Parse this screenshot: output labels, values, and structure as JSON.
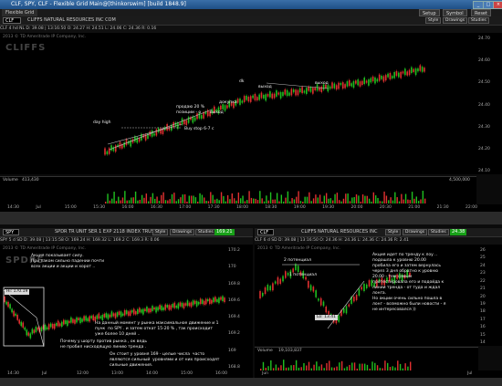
{
  "titlebar": {
    "title": "CLF, SPY, CLF - Flexible Grid Main@[thinkorswim] [build 1848.9]"
  },
  "window_controls": [
    "_",
    "□",
    "×"
  ],
  "tabs": [
    "Flexible Grid"
  ],
  "top_buttons": [
    "Setup",
    "Symbol",
    "Reset"
  ],
  "top": {
    "symbol": "CLF",
    "desc": "CLIFFS NATURAL RESOURCES INC COM",
    "quote": "CLF 4 hd NL  D: 39.08 | 13:16:50  O: 24.27  H: 24.51  L: 24.06  C: 24.36  R: 0.16",
    "copyright": "2013 © TD Ameritrade IP Company, Inc.",
    "logo": "CLIFFS",
    "buttons": [
      "Style",
      "Drawings",
      "Studies"
    ],
    "annotations": {
      "day_high": "day high",
      "buy_stop": "Buy stop 6-7 c",
      "sold": "продаю 20 %\nпозиции - о",
      "exit1": "выход",
      "addon": "докупка",
      "exit2": "выход",
      "exit3": "выход",
      "dk": "dk"
    },
    "price_ticks": [
      "24.70",
      "24.60",
      "24.50",
      "24.40",
      "24.30",
      "24.20",
      "24.10"
    ],
    "time_ticks": [
      "14:30",
      "Jul",
      "15:00",
      "15:30",
      "16:00",
      "16:30",
      "17:00",
      "17:30",
      "18:00",
      "18:30",
      "19:00",
      "19:30",
      "20:00",
      "20:30",
      "21:00",
      "21:30",
      "22:00"
    ],
    "volume_label": "Volume",
    "volume_value": "413,430",
    "volume_right": "4,500,000"
  },
  "left": {
    "symbol": "SPY",
    "desc": "SPDR TR UNIT SER 1 EXP 2118 INDEX TRUST",
    "price": "169.21",
    "quote": "SPY 5 d SD  D: 39.08 | 13:15:58  O: 169.24  H: 169.32  L: 169.2  C: 169.3  R: 0.06",
    "buttons": [
      "Style",
      "Drawings",
      "Studies"
    ],
    "copyright": "2013 © TD Ameritrade IP Company, Inc.",
    "logo": "SPDRS",
    "hi_label": "Hi: 170.19",
    "price_ticks": [
      "170.2",
      "170",
      "169.8",
      "169.6",
      "169.4",
      "169.2",
      "169",
      "168.8"
    ],
    "time_ticks": [
      "14:30",
      "Jul",
      "12:00",
      "13:00",
      "14:00",
      "15:00",
      "16:00"
    ],
    "annotations": {
      "a1": "Акция показывает силу.\nПри таком сильно падении почти\nвсех акции и акции и хорот ..",
      "a2": "На данный момент у рынка максимальное движение и 1\nпунк  по SPY . и затем откат 15-20 % , так происходит\nуже более 10 дней ..",
      "a3": "Почему у шорту против рынка , ок ведь\nне пробил нисходящую линию тренда .",
      "a4": "Он стоит у уровня 169 - целые числа  часто\nявляются сильный  уровнями и от них происходят\nсильные движения."
    }
  },
  "right": {
    "symbol": "CLF",
    "desc": "CLIFFS NATURAL RESOURCES INC",
    "price": "24.38",
    "quote": "CLF 6 d SD  D: 39.08 | 13:16:50  O: 24.36  H: 24.36  L: 24.36  C: 24.36  R: 2.41",
    "buttons": [
      "Style",
      "Drawings",
      "Studies"
    ],
    "copyright": "2013 © TD Ameritrade IP Company, Inc.",
    "lo_label": "Lo: 13.41",
    "ann": {
      "p2": "2 потенциал",
      "p1": "1 потенциал",
      "big": "Акция идет по тренду к лоу ..\nподошла к уровню 20.00\nпробила его и затем вернулась\nчерез 3 дня обратно к уровню\n20.00 - тем самым\nпротестировала его и подойда к\nлинии тренда - от туда и ждал\nлонга.\nНо акции очень сильно пошла в\nлонг - возможно были новости - я\nне интересовался ))"
    },
    "price_ticks": [
      "26",
      "25",
      "24",
      "23",
      "22",
      "21",
      "20",
      "19",
      "18",
      "17",
      "16",
      "15",
      "14"
    ],
    "time_ticks": [
      "Jun",
      "Jul"
    ],
    "volume_label": "Volume",
    "volume_value": "19,103,837"
  },
  "colors": {
    "up": "#20c020",
    "down": "#e03030",
    "hl": "#1fe01f",
    "white": "#ffffff"
  }
}
